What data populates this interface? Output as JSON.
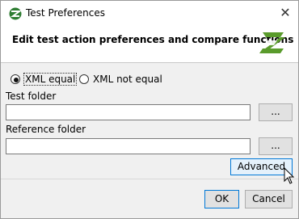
{
  "window": {
    "title": "Test Preferences",
    "close_label": "✕"
  },
  "header": {
    "title": "Edit test action preferences and compare functions"
  },
  "options": [
    {
      "label": "XML equal",
      "selected": true
    },
    {
      "label": "XML not equal",
      "selected": false
    }
  ],
  "test_folder": {
    "label": "Test folder",
    "value": "",
    "browse_label": "..."
  },
  "reference_folder": {
    "label": "Reference folder",
    "value": "",
    "browse_label": "..."
  },
  "buttons": {
    "advanced": "Advanced",
    "ok": "OK",
    "cancel": "Cancel"
  },
  "colors": {
    "logo_green": "#5a9b2c",
    "accent_border": "#0078d7"
  }
}
